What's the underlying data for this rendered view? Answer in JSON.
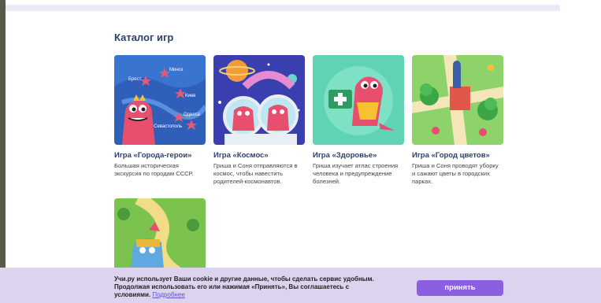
{
  "catalog": {
    "title": "Каталог игр",
    "games": [
      {
        "title": "Игра «Города-герои»",
        "desc": "Большая историческая экскурсия по городам СССР.",
        "image": "map-cities-dino-icon",
        "cities": [
          "Минск",
          "Брест",
          "Киев",
          "Одесса",
          "Севастополь"
        ]
      },
      {
        "title": "Игра «Космос»",
        "desc": "Гриша и Соня отправляются в космос, чтобы навестить родителей-космонавтов.",
        "image": "space-dinos-icon"
      },
      {
        "title": "Игра «Здоровье»",
        "desc": "Гриша изучает атлас строения человека и предупреждение болезней.",
        "image": "health-dino-icon"
      },
      {
        "title": "Игра «Город цветов»",
        "desc": "Гриша и Соня проводят уборку и сажают цветы в городских парках.",
        "image": "park-flowers-icon"
      },
      {
        "title": "",
        "desc": "",
        "image": "knight-dino-icon"
      }
    ]
  },
  "cookie": {
    "text": "Учи.ру использует Ваши cookie и другие данные, чтобы сделать сервис удобным. Продолжая использовать его или нажимая «Принять», Вы соглашаетесь с условиями.",
    "link": "Подробнее",
    "accept": "принять"
  },
  "colors": {
    "accent": "#8a5fe0",
    "title": "#2a3f6e",
    "cookie_bg": "#dcd3ee"
  }
}
